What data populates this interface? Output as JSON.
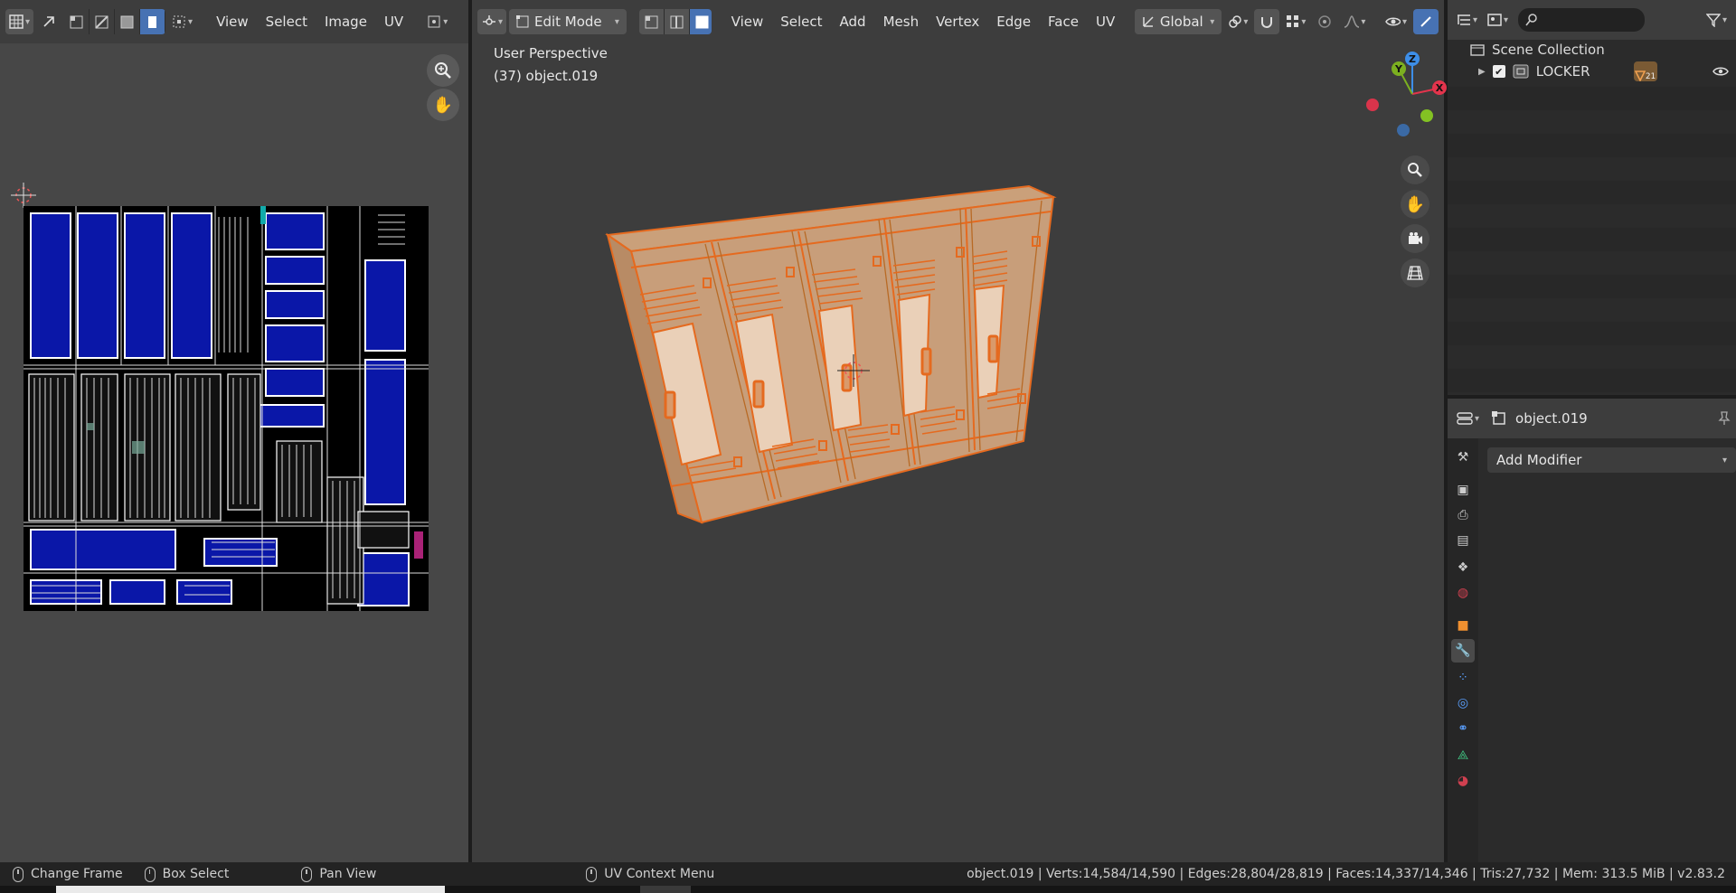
{
  "uv_editor": {
    "menu": [
      "View",
      "Select",
      "Image",
      "UV"
    ]
  },
  "viewport": {
    "mode": "Edit Mode",
    "menu": [
      "View",
      "Select",
      "Add",
      "Mesh",
      "Vertex",
      "Edge",
      "Face",
      "UV"
    ],
    "orientation": "Global",
    "overlay_perspective": "User Perspective",
    "overlay_object": "(37) object.019",
    "gizmo_axes": {
      "x": "X",
      "y": "Y",
      "z": "Z"
    },
    "accent": "#4772b3",
    "mesh_color": "#e56a1f"
  },
  "outliner": {
    "root": "Scene Collection",
    "items": [
      {
        "name": "LOCKER",
        "badge": "21"
      }
    ]
  },
  "properties": {
    "object_name": "object.019",
    "add_modifier": "Add Modifier"
  },
  "statusbar": {
    "hints": [
      "Change Frame",
      "Box Select",
      "Pan View",
      "UV Context Menu"
    ],
    "stats": "object.019 | Verts:14,584/14,590 | Edges:28,804/28,819 | Faces:14,337/14,346 | Tris:27,732 | Mem: 313.5 MiB | v2.83.2"
  }
}
